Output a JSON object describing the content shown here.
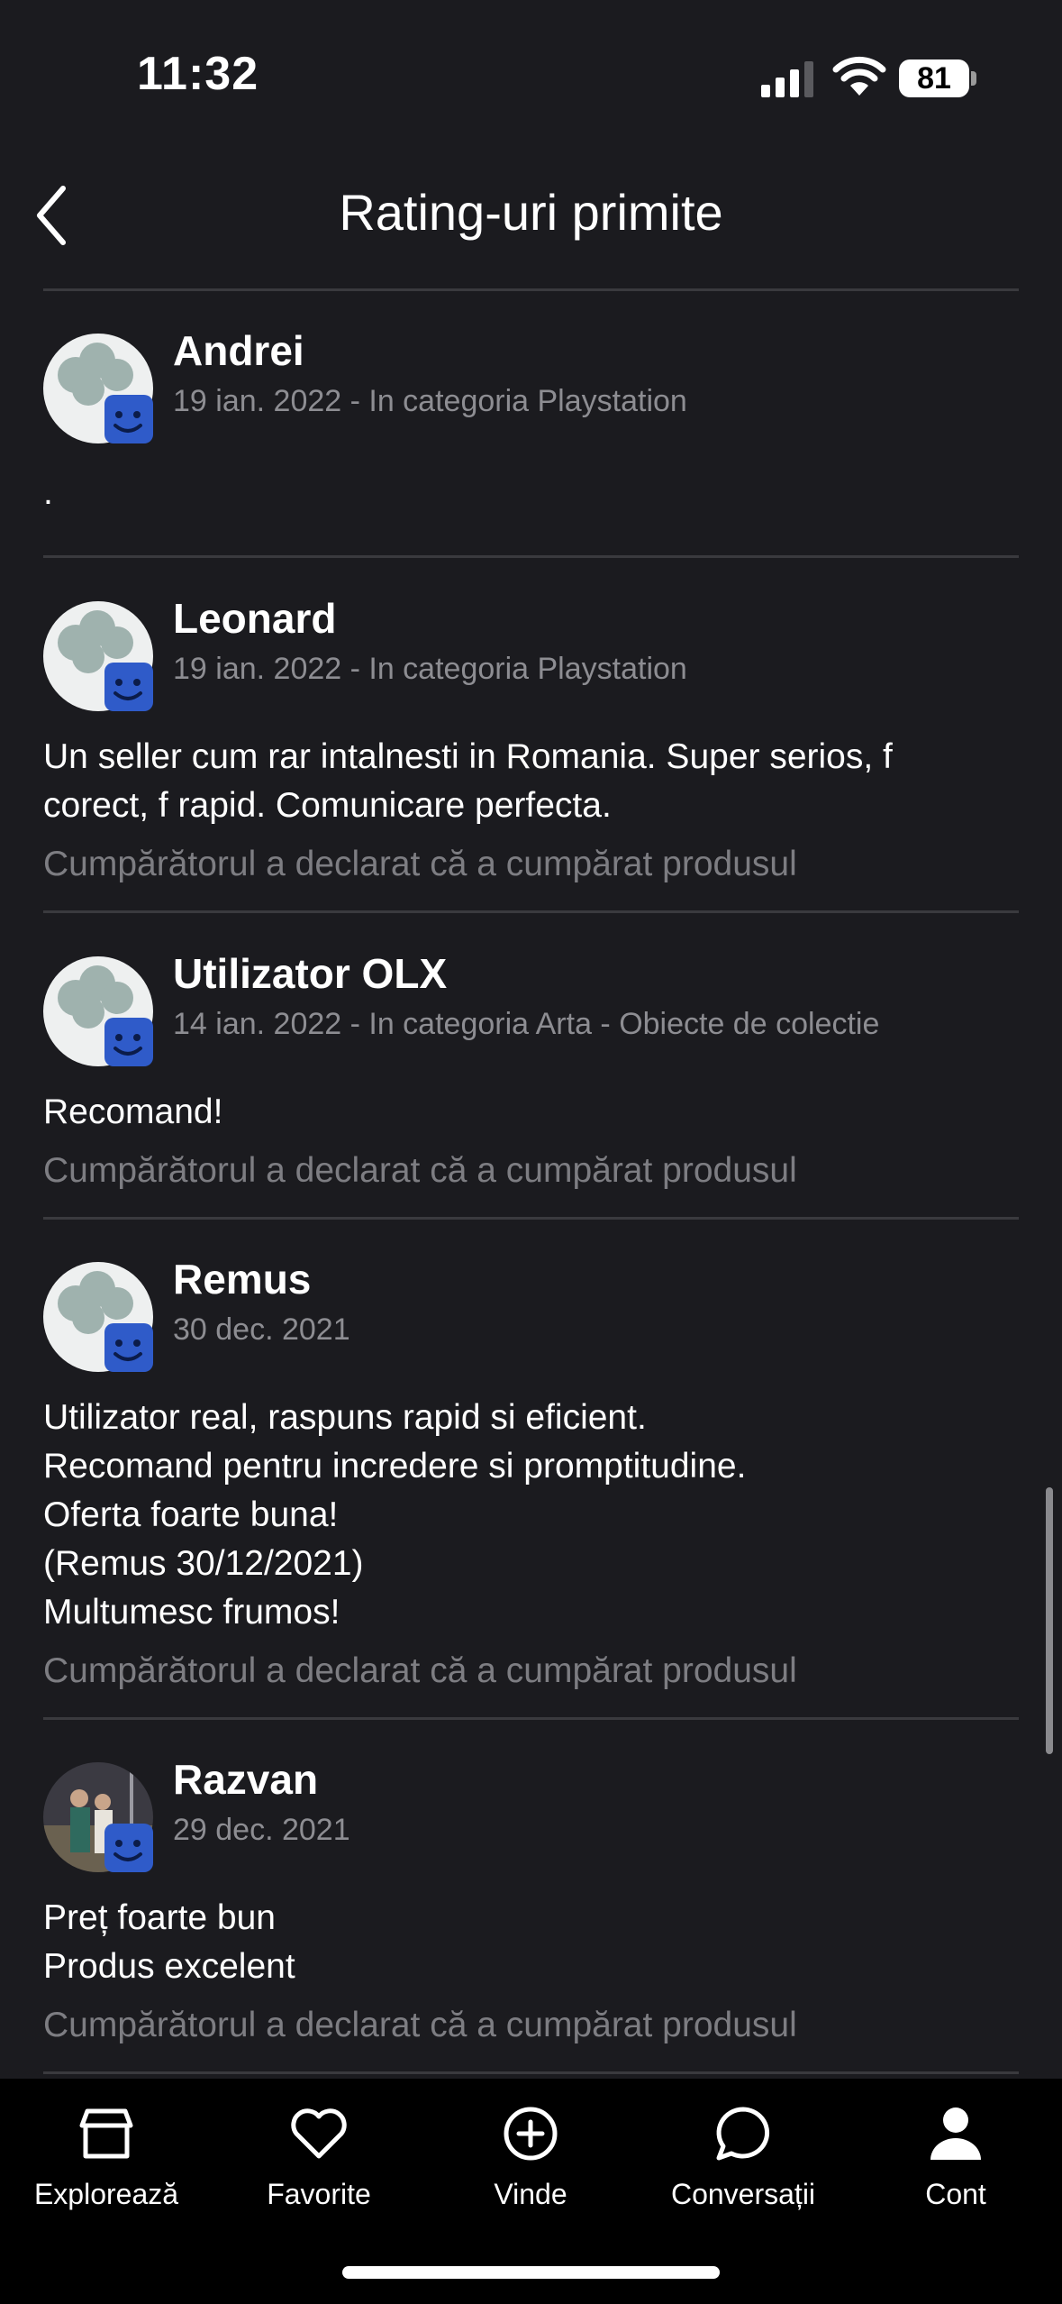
{
  "status_bar": {
    "time": "11:32",
    "battery": "81"
  },
  "header": {
    "title": "Rating-uri primite"
  },
  "reviews": [
    {
      "name": "Andrei",
      "meta": "19 ian. 2022 - In categoria Playstation",
      "text": ".",
      "note": ""
    },
    {
      "name": "Leonard",
      "meta": "19 ian. 2022 - In categoria Playstation",
      "text": "Un seller cum rar intalnesti in Romania. Super serios, f\ncorect, f rapid. Comunicare perfecta.",
      "note": "Cumpărătorul a declarat că a cumpărat produsul"
    },
    {
      "name": "Utilizator OLX",
      "meta": "14 ian. 2022 - In categoria Arta - Obiecte de colectie",
      "text": "Recomand!",
      "note": "Cumpărătorul a declarat că a cumpărat produsul"
    },
    {
      "name": "Remus",
      "meta": "30 dec. 2021",
      "text": "Utilizator real, raspuns rapid si eficient.\nRecomand pentru incredere si promptitudine.\nOferta foarte buna!\n(Remus 30/12/2021)\nMultumesc frumos!",
      "note": "Cumpărătorul a declarat că a cumpărat produsul"
    },
    {
      "name": "Razvan",
      "meta": "29 dec. 2021",
      "text": "Preț foarte bun\nProdus excelent",
      "note": "Cumpărătorul a declarat că a cumpărat produsul"
    }
  ],
  "nav": {
    "items": [
      {
        "label": "Explorează",
        "icon": "store-icon"
      },
      {
        "label": "Favorite",
        "icon": "heart-icon"
      },
      {
        "label": "Vinde",
        "icon": "plus-circle-icon"
      },
      {
        "label": "Conversații",
        "icon": "chat-icon"
      },
      {
        "label": "Cont",
        "icon": "user-icon"
      }
    ]
  },
  "colors": {
    "background": "#1b1b1f",
    "badge": "#2f5bc9",
    "muted_text": "#8d8d92",
    "divider": "#3a3a3e"
  }
}
